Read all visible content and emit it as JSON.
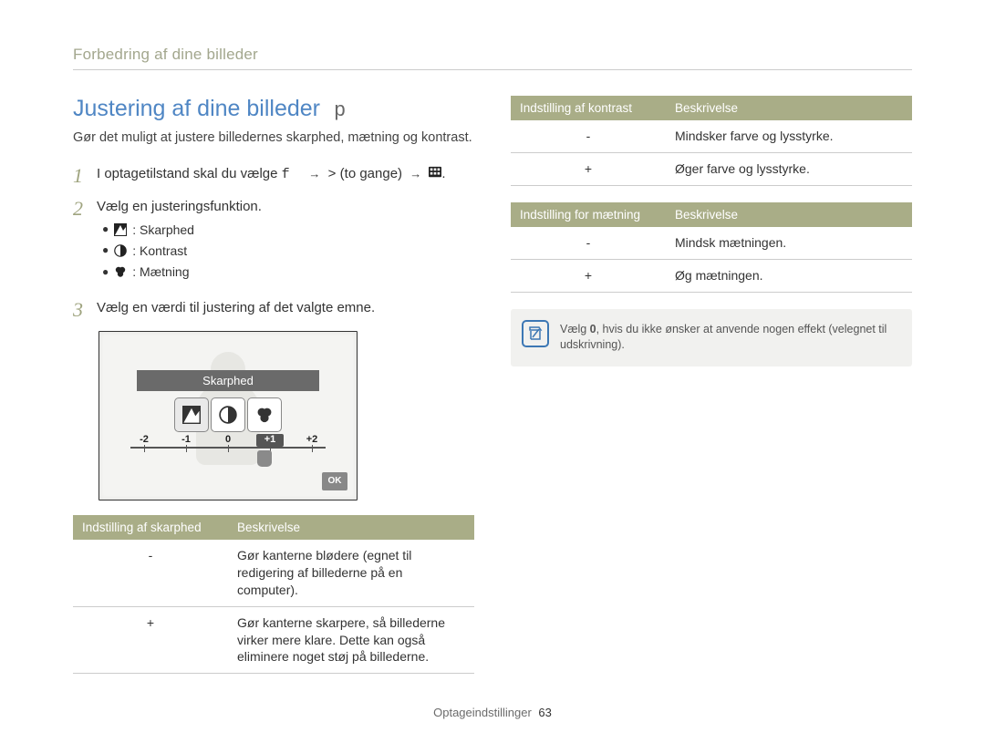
{
  "breadcrumb": "Forbedring af dine billeder",
  "section": {
    "title": "Justering af dine billeder",
    "title_suffix": "p",
    "intro": "Gør det muligt at justere billedernes skarphed, mætning og kontrast."
  },
  "steps": {
    "s1": {
      "num": "1",
      "text_prefix": "I optagetilstand skal du vælge ",
      "text_mono1": "f",
      "arrow1": "→",
      "chev": ">",
      "parenthetical": " (to gange)",
      "arrow2": "→",
      "suffix": "."
    },
    "s2": {
      "num": "2",
      "text": "Vælg en justeringsfunktion.",
      "items": [
        {
          "label": "Skarphed",
          "icon": "sharpness-icon"
        },
        {
          "label": "Kontrast",
          "icon": "contrast-icon"
        },
        {
          "label": "Mætning",
          "icon": "saturation-icon"
        }
      ]
    },
    "s3": {
      "num": "3",
      "text": "Vælg en værdi til justering af det valgte emne."
    }
  },
  "screenshot": {
    "label": "Skarphed",
    "ticks": [
      "-2",
      "-1",
      "0",
      "+1",
      "+2"
    ],
    "selected_tick": "+1",
    "ok": "OK"
  },
  "tables": {
    "sharpness": {
      "h1": "Indstilling af skarphed",
      "h2": "Beskrivelse",
      "rows": [
        {
          "k": "-",
          "v": "Gør kanterne blødere (egnet til redigering af billederne på en computer)."
        },
        {
          "k": "+",
          "v": "Gør kanterne skarpere, så billederne virker mere klare. Dette kan også eliminere noget støj på billederne."
        }
      ]
    },
    "contrast": {
      "h1": "Indstilling af kontrast",
      "h2": "Beskrivelse",
      "rows": [
        {
          "k": "-",
          "v": "Mindsker farve og lysstyrke."
        },
        {
          "k": "+",
          "v": "Øger farve og lysstyrke."
        }
      ]
    },
    "saturation": {
      "h1": "Indstilling for mætning",
      "h2": "Beskrivelse",
      "rows": [
        {
          "k": "-",
          "v": "Mindsk mætningen."
        },
        {
          "k": "+",
          "v": "Øg mætningen."
        }
      ]
    }
  },
  "note": {
    "text_prefix": "Vælg ",
    "bold": "0",
    "text_suffix": ", hvis du ikke ønsker at anvende nogen effekt (velegnet til udskrivning)."
  },
  "footer": {
    "label": "Optageindstillinger",
    "page": "63"
  }
}
